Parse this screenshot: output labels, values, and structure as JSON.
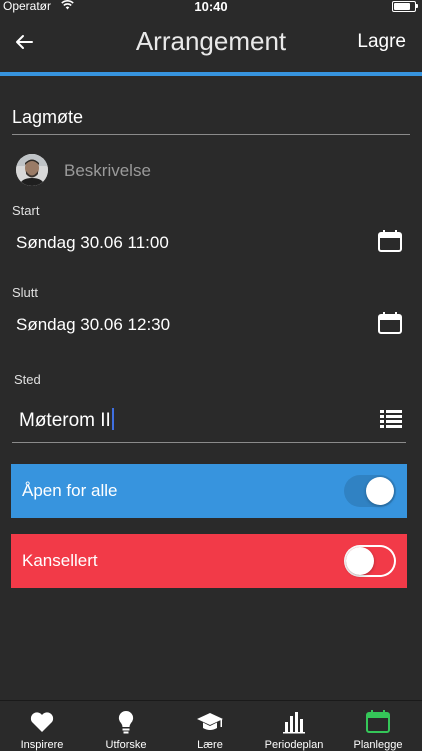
{
  "status_bar": {
    "carrier": "Operatør",
    "time": "10:40"
  },
  "nav": {
    "title": "Arrangement",
    "save_label": "Lagre"
  },
  "colors": {
    "accent": "#3794de",
    "open_row": "#3794de",
    "cancel_row": "#f23a48",
    "active_tab": "#35c759"
  },
  "event": {
    "title": "Lagmøte",
    "description_placeholder": "Beskrivelse",
    "start_label": "Start",
    "start_value": "Søndag 30.06 11:00",
    "end_label": "Slutt",
    "end_value": "Søndag 30.06 12:30",
    "place_label": "Sted",
    "place_value": "Møterom II"
  },
  "toggles": {
    "open_label": "Åpen for alle",
    "open_on": true,
    "cancelled_label": "Kansellert",
    "cancelled_on": false
  },
  "tabs": [
    {
      "label": "Inspirere",
      "icon": "heart-icon"
    },
    {
      "label": "Utforske",
      "icon": "lightbulb-icon"
    },
    {
      "label": "Lære",
      "icon": "graduation-cap-icon"
    },
    {
      "label": "Periodeplan",
      "icon": "bar-chart-icon"
    },
    {
      "label": "Planlegge",
      "icon": "calendar-icon",
      "active": true
    }
  ]
}
